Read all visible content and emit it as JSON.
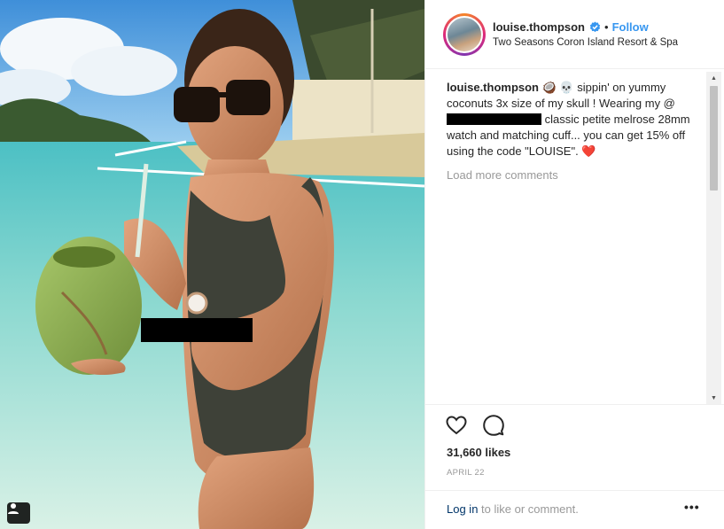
{
  "post": {
    "username": "louise.thompson",
    "follow_separator": "•",
    "follow_label": "Follow",
    "location": "Two Seasons Coron Island Resort & Spa",
    "verified_icon": "verified-badge-icon"
  },
  "caption": {
    "username": "louise.thompson",
    "emoji": "🥥 💀",
    "text_1": "sippin' on yummy coconuts 3x size of my skull ! Wearing my @",
    "text_2": "classic petite melrose 28mm watch and matching cuff... you can get 15% off using the code \"LOUISE\".",
    "end_emoji": "❤️"
  },
  "comments": {
    "load_more": "Load more comments"
  },
  "scrollbar": {
    "up_arrow": "▲",
    "down_arrow": "▼"
  },
  "actions": {
    "like_icon": "heart-icon",
    "comment_icon": "comment-icon",
    "likes": "31,660 likes",
    "date": "APRIL 22"
  },
  "footer": {
    "login_link": "Log in",
    "login_rest": " to like or comment.",
    "more": "•••"
  },
  "colors": {
    "link_blue": "#3897f0",
    "verified_blue": "#3897f0",
    "muted": "#999999",
    "text": "#262626"
  }
}
